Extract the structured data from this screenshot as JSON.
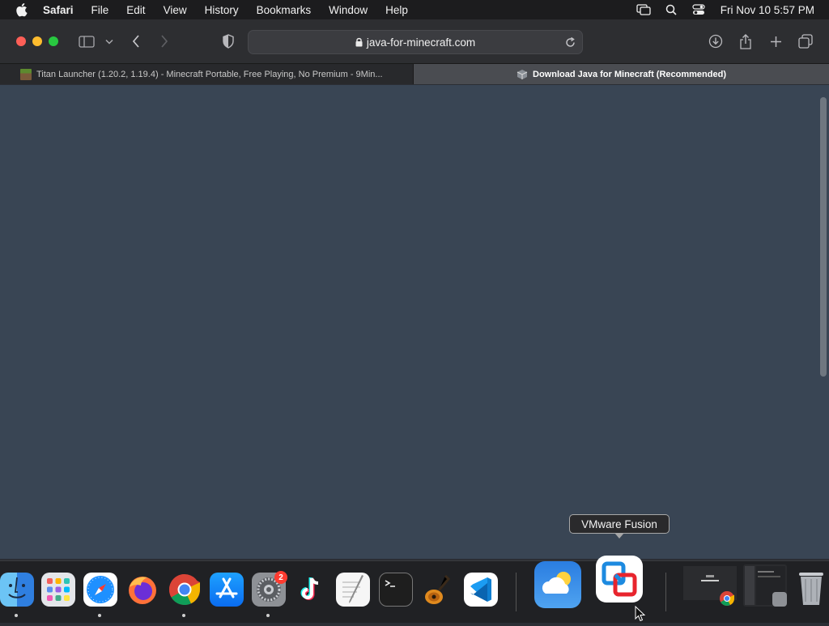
{
  "menubar": {
    "app_name": "Safari",
    "items": [
      "File",
      "Edit",
      "View",
      "History",
      "Bookmarks",
      "Window",
      "Help"
    ],
    "clock": "Fri Nov 10  5:57 PM",
    "status_icons": [
      "screen-mirroring-icon",
      "spotlight-search-icon",
      "control-center-icon"
    ]
  },
  "toolbar": {
    "url": "java-for-minecraft.com"
  },
  "tabs": [
    {
      "title": "Titan Launcher (1.20.2, 1.19.4) - Minecraft Portable, Free Playing, No Premium - 9Min...",
      "active": false
    },
    {
      "title": "Download Java for Minecraft (Recommended)",
      "active": true
    }
  ],
  "content": {
    "background": "#394554"
  },
  "dock": {
    "tooltip": "VMware Fusion",
    "apps": [
      "Finder",
      "Launchpad",
      "Safari",
      "Firefox",
      "Google Chrome",
      "App Store",
      "System Settings",
      "TikTok",
      "TextEdit",
      "Terminal",
      "GarageBand",
      "Visual Studio Code",
      "Weather",
      "VMware Fusion"
    ],
    "settings_badge": "2"
  },
  "colors": {
    "menubar": "#1c1c1e",
    "toolbar": "#2d2e31",
    "active_tab": "#4a4c51",
    "close": "#fe5f57",
    "minimize": "#febc2e",
    "zoom": "#28c840"
  }
}
